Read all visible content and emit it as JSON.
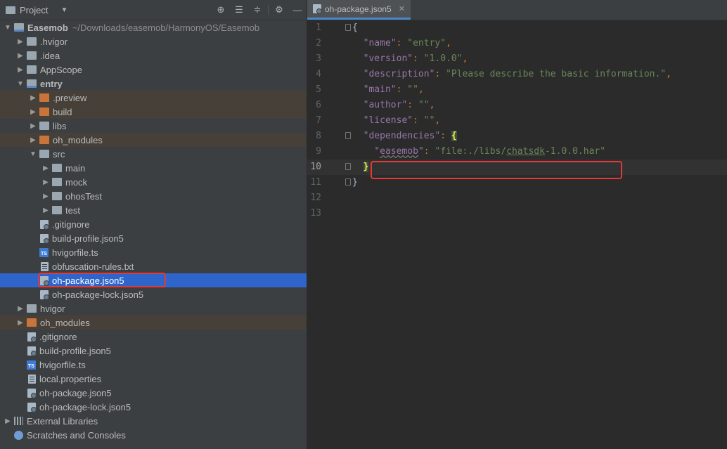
{
  "project_panel": {
    "title": "Project",
    "tree": [
      {
        "label": "Easemob",
        "path": "~/Downloads/easemob/HarmonyOS/Easemob",
        "depth": 0,
        "icon": "module-folder-icon",
        "chevron": "down",
        "bold": true
      },
      {
        "label": ".hvigor",
        "depth": 1,
        "icon": "folder-icon",
        "chevron": "right"
      },
      {
        "label": ".idea",
        "depth": 1,
        "icon": "folder-icon",
        "chevron": "right"
      },
      {
        "label": "AppScope",
        "depth": 1,
        "icon": "folder-icon",
        "chevron": "right"
      },
      {
        "label": "entry",
        "depth": 1,
        "icon": "module-folder-icon",
        "chevron": "down",
        "bold": true
      },
      {
        "label": ".preview",
        "depth": 2,
        "icon": "excluded-folder-icon",
        "chevron": "right",
        "highlight": true
      },
      {
        "label": "build",
        "depth": 2,
        "icon": "excluded-folder-icon",
        "chevron": "right",
        "highlight": true
      },
      {
        "label": "libs",
        "depth": 2,
        "icon": "folder-icon",
        "chevron": "right"
      },
      {
        "label": "oh_modules",
        "depth": 2,
        "icon": "excluded-folder-icon",
        "chevron": "right",
        "highlight": true
      },
      {
        "label": "src",
        "depth": 2,
        "icon": "folder-icon",
        "chevron": "down"
      },
      {
        "label": "main",
        "depth": 3,
        "icon": "folder-icon",
        "chevron": "right"
      },
      {
        "label": "mock",
        "depth": 3,
        "icon": "folder-icon",
        "chevron": "right"
      },
      {
        "label": "ohosTest",
        "depth": 3,
        "icon": "folder-icon",
        "chevron": "right"
      },
      {
        "label": "test",
        "depth": 3,
        "icon": "folder-icon",
        "chevron": "right"
      },
      {
        "label": ".gitignore",
        "depth": 2,
        "icon": "config-file-icon",
        "chevron": "none"
      },
      {
        "label": "build-profile.json5",
        "depth": 2,
        "icon": "json5-file-icon",
        "chevron": "none"
      },
      {
        "label": "hvigorfile.ts",
        "depth": 2,
        "icon": "typescript-file-icon",
        "chevron": "none"
      },
      {
        "label": "obfuscation-rules.txt",
        "depth": 2,
        "icon": "text-file-icon",
        "chevron": "none"
      },
      {
        "label": "oh-package.json5",
        "depth": 2,
        "icon": "json5-file-icon",
        "chevron": "none",
        "selected": true
      },
      {
        "label": "oh-package-lock.json5",
        "depth": 2,
        "icon": "json5-file-icon",
        "chevron": "none"
      },
      {
        "label": "hvigor",
        "depth": 1,
        "icon": "folder-icon",
        "chevron": "right"
      },
      {
        "label": "oh_modules",
        "depth": 1,
        "icon": "excluded-folder-icon",
        "chevron": "right",
        "highlight": true
      },
      {
        "label": ".gitignore",
        "depth": 1,
        "icon": "config-file-icon",
        "chevron": "none"
      },
      {
        "label": "build-profile.json5",
        "depth": 1,
        "icon": "json5-file-icon",
        "chevron": "none"
      },
      {
        "label": "hvigorfile.ts",
        "depth": 1,
        "icon": "typescript-file-icon",
        "chevron": "none"
      },
      {
        "label": "local.properties",
        "depth": 1,
        "icon": "properties-file-icon",
        "chevron": "none"
      },
      {
        "label": "oh-package.json5",
        "depth": 1,
        "icon": "json5-file-icon",
        "chevron": "none"
      },
      {
        "label": "oh-package-lock.json5",
        "depth": 1,
        "icon": "json5-file-icon",
        "chevron": "none"
      },
      {
        "label": "External Libraries",
        "depth": 0,
        "icon": "library-icon",
        "chevron": "right"
      },
      {
        "label": "Scratches and Consoles",
        "depth": 0,
        "icon": "scratches-icon",
        "chevron": "none"
      }
    ]
  },
  "editor": {
    "tab_label": "oh-package.json5",
    "current_line": 10,
    "lines": [
      {
        "n": "1",
        "code": "{"
      },
      {
        "n": "2",
        "code": "  \"name\": \"entry\","
      },
      {
        "n": "3",
        "code": "  \"version\": \"1.0.0\","
      },
      {
        "n": "4",
        "code": "  \"description\": \"Please describe the basic information.\","
      },
      {
        "n": "5",
        "code": "  \"main\": \"\","
      },
      {
        "n": "6",
        "code": "  \"author\": \"\","
      },
      {
        "n": "7",
        "code": "  \"license\": \"\","
      },
      {
        "n": "8",
        "code": "  \"dependencies\": {"
      },
      {
        "n": "9",
        "code": "    \"easemob\": \"file:./libs/chatsdk-1.0.0.har\""
      },
      {
        "n": "10",
        "code": "  }"
      },
      {
        "n": "11",
        "code": "}"
      },
      {
        "n": "12",
        "code": ""
      },
      {
        "n": "13",
        "code": ""
      }
    ]
  },
  "colors": {
    "panel_bg": "#3c3f41",
    "editor_bg": "#2b2b2b",
    "selection": "#2f65ca",
    "excluded_highlight": "#464039",
    "annotation_red": "#e53935",
    "json_key": "#9876aa",
    "json_string": "#6a8759"
  }
}
